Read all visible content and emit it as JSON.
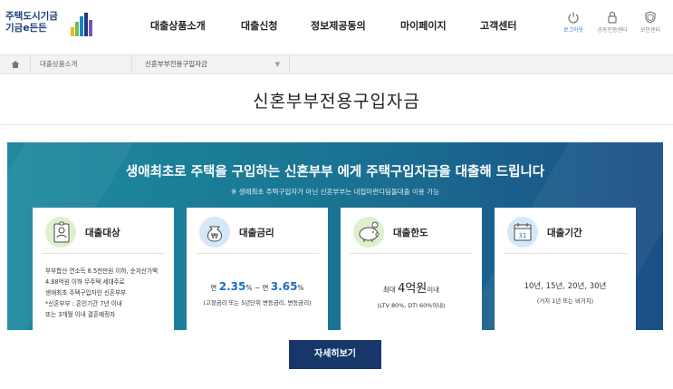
{
  "header": {
    "logo_line1": "주택도시기금",
    "logo_line2": "기금e든든",
    "nav": [
      "대출상품소개",
      "대출신청",
      "정보제공동의",
      "마이페이지",
      "고객센터"
    ],
    "util": [
      {
        "label": "로그아웃",
        "icon": "power-icon"
      },
      {
        "label": "공동인증센터",
        "icon": "lock-icon"
      },
      {
        "label": "보안센터",
        "icon": "shield-icon"
      }
    ]
  },
  "breadcrumb": {
    "item1": "대출상품소개",
    "item2": "신혼부부전용구입자금"
  },
  "page_title": "신혼부부전용구입자금",
  "banner": {
    "headline": "생애최초로 주택을 구입하는 신혼부부 에게  주택구입자금을 대출해 드립니다",
    "sub": "※ 생애최초 주택구입자가 아닌 신혼부부는 내집마련디딤돌대출 이용 가능"
  },
  "cards": [
    {
      "title": "대출대상",
      "icon": "id-card-icon",
      "lines": [
        "부부합산 연소득 8.5천만원 이하, 순자산가액",
        "4.88억원 이하 무주택 세대주로",
        "생애최초 주택구입자인 신혼부부",
        "*신혼부부 : 혼인기간 7년 이내",
        "또는 3개월 이내 결혼예정자"
      ]
    },
    {
      "title": "대출금리",
      "icon": "money-bag-icon",
      "rate_prefix1": "연 ",
      "rate_low": "2.35",
      "rate_pct": "%",
      "rate_sep": " ~ 연 ",
      "rate_high": "3.65",
      "note": "(고정금리 또는 5년단위 변동금리, 변동금리)"
    },
    {
      "title": "대출한도",
      "icon": "piggy-bank-icon",
      "limit_prefix": "최대 ",
      "limit_value": "4억원",
      "limit_suffix": "이내",
      "note": "(LTV 80%, DTI 60%이내)"
    },
    {
      "title": "대출기간",
      "icon": "calendar-icon",
      "calendar_day": "31",
      "period": "10년, 15년, 20년, 30년",
      "note": "(거치 1년 또는 비거치)"
    }
  ],
  "detail_button": "자세히보기"
}
